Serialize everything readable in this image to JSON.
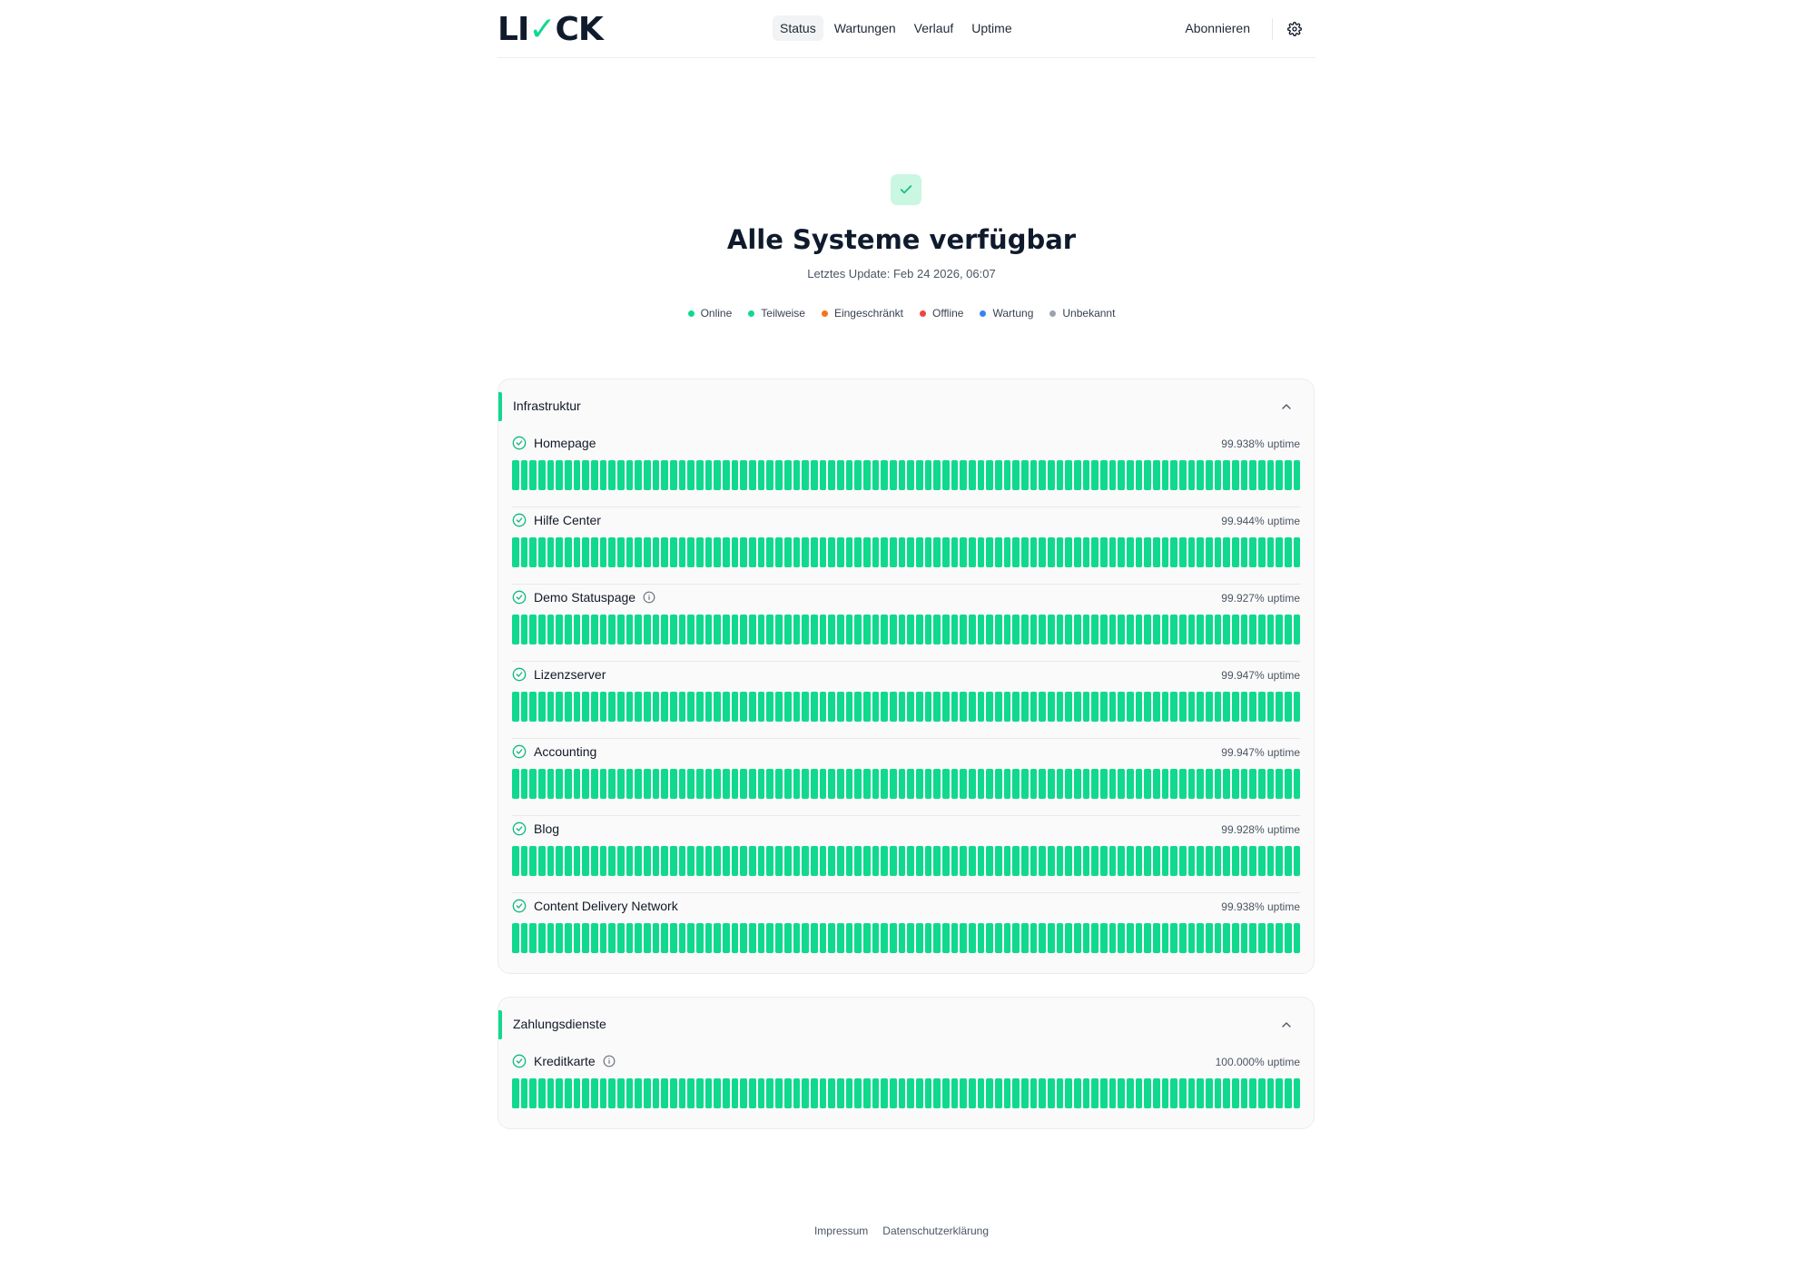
{
  "header": {
    "logo_left": "LI",
    "logo_check": "✓",
    "logo_right": "CK",
    "nav": [
      {
        "label": "Status",
        "active": true
      },
      {
        "label": "Wartungen",
        "active": false
      },
      {
        "label": "Verlauf",
        "active": false
      },
      {
        "label": "Uptime",
        "active": false
      }
    ],
    "subscribe": "Abonnieren",
    "settings_icon": "gear-icon"
  },
  "hero": {
    "icon": "check-icon",
    "title": "Alle Systeme verfügbar",
    "subtitle": "Letztes Update: Feb 24 2026, 06:07"
  },
  "legend": [
    {
      "label": "Online",
      "color": "#10d98e"
    },
    {
      "label": "Teilweise",
      "color": "#10d98e"
    },
    {
      "label": "Eingeschränkt",
      "color": "#f97316"
    },
    {
      "label": "Offline",
      "color": "#ef4444"
    },
    {
      "label": "Wartung",
      "color": "#3b82f6"
    },
    {
      "label": "Unbekannt",
      "color": "#9ca3af"
    }
  ],
  "groups": [
    {
      "title": "Infrastruktur",
      "services": [
        {
          "name": "Homepage",
          "uptime": "99.938% uptime",
          "info": false
        },
        {
          "name": "Hilfe Center",
          "uptime": "99.944% uptime",
          "info": false
        },
        {
          "name": "Demo Statuspage",
          "uptime": "99.927% uptime",
          "info": true
        },
        {
          "name": "Lizenzserver",
          "uptime": "99.947% uptime",
          "info": false
        },
        {
          "name": "Accounting",
          "uptime": "99.947% uptime",
          "info": false
        },
        {
          "name": "Blog",
          "uptime": "99.928% uptime",
          "info": false
        },
        {
          "name": "Content Delivery Network",
          "uptime": "99.938% uptime",
          "info": false
        }
      ]
    },
    {
      "title": "Zahlungsdienste",
      "services": [
        {
          "name": "Kreditkarte",
          "uptime": "100.000% uptime",
          "info": true
        }
      ]
    }
  ],
  "colors": {
    "accent": "#10d98e"
  },
  "footer": {
    "impressum": "Impressum",
    "privacy": "Datenschutzerklärung"
  }
}
